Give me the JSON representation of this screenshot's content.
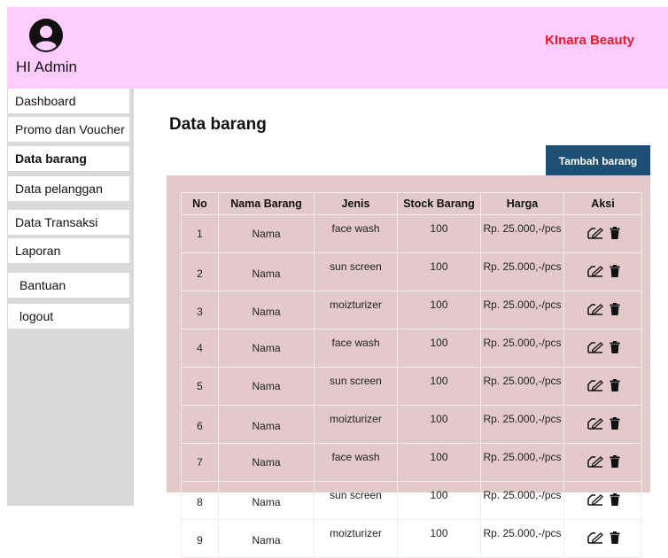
{
  "header": {
    "greeting": "HI Admin",
    "brand": "KInara Beauty",
    "brand_color": "#e8182a",
    "background": "#ffccff",
    "avatar_icon": "user-circle-icon"
  },
  "sidebar": {
    "items": [
      {
        "label": "Dashboard",
        "active": false
      },
      {
        "label": "Promo dan Voucher",
        "active": false
      },
      {
        "label": "Data barang",
        "active": true
      },
      {
        "label": "Data pelanggan",
        "active": false
      },
      {
        "label": "Data Transaksi",
        "active": false
      },
      {
        "label": "Laporan",
        "active": false
      },
      {
        "label": "Bantuan",
        "active": false
      },
      {
        "label": "logout",
        "active": false
      }
    ]
  },
  "main": {
    "title": "Data barang",
    "add_button": "Tambah barang",
    "add_button_color": "#1c4f73",
    "table": {
      "headers": [
        "No",
        "Nama  Barang",
        "Jenis",
        "Stock Barang",
        "Harga",
        "Aksi"
      ],
      "rows": [
        {
          "no": "1",
          "nama": "Nama",
          "jenis": "face wash",
          "stock": "100",
          "harga": "Rp. 25.000,-/pcs"
        },
        {
          "no": "2",
          "nama": "Nama",
          "jenis": "sun screen",
          "stock": "100",
          "harga": "Rp. 25.000,-/pcs"
        },
        {
          "no": "3",
          "nama": "Nama",
          "jenis": "moizturizer",
          "stock": "100",
          "harga": "Rp. 25.000,-/pcs"
        },
        {
          "no": "4",
          "nama": "Nama",
          "jenis": "face wash",
          "stock": "100",
          "harga": "Rp. 25.000,-/pcs"
        },
        {
          "no": "5",
          "nama": "Nama",
          "jenis": "sun screen",
          "stock": "100",
          "harga": "Rp. 25.000,-/pcs"
        },
        {
          "no": "6",
          "nama": "Nama",
          "jenis": "moizturizer",
          "stock": "100",
          "harga": "Rp. 25.000,-/pcs"
        },
        {
          "no": "7",
          "nama": "Nama",
          "jenis": "face wash",
          "stock": "100",
          "harga": "Rp. 25.000,-/pcs"
        },
        {
          "no": "8",
          "nama": "Nama",
          "jenis": "sun screen",
          "stock": "100",
          "harga": "Rp. 25.000,-/pcs"
        },
        {
          "no": "9",
          "nama": "Nama",
          "jenis": "moizturizer",
          "stock": "100",
          "harga": "Rp. 25.000,-/pcs"
        }
      ],
      "action_icons": [
        "edit-icon",
        "trash-icon"
      ]
    }
  }
}
